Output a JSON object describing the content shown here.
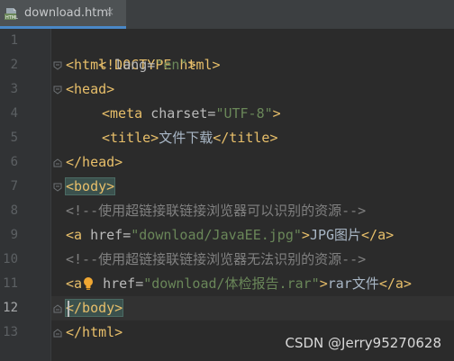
{
  "tab": {
    "filename": "download.html",
    "close_glyph": "×",
    "icon": "html-file-icon"
  },
  "gutter": {
    "lines": [
      "1",
      "2",
      "3",
      "4",
      "5",
      "6",
      "7",
      "8",
      "9",
      "10",
      "11",
      "12",
      "13"
    ],
    "active_line": "12"
  },
  "code": {
    "l1": {
      "tag": "<!DOCTYPE html>"
    },
    "l2": {
      "open": "<html ",
      "attr": "lang=",
      "val": "\"en\"",
      "close": ">"
    },
    "l3": {
      "tag": "<head>"
    },
    "l4": {
      "open": "<meta ",
      "attr": "charset=",
      "val": "\"UTF-8\"",
      "close": ">"
    },
    "l5": {
      "open": "<title>",
      "text": "文件下载",
      "close": "</title>"
    },
    "l6": {
      "tag": "</head>"
    },
    "l7": {
      "tag": "<body>"
    },
    "l8": {
      "comment": "<!--使用超链接联链接浏览器可以识别的资源-->"
    },
    "l9": {
      "open": "<a ",
      "attr": "href=",
      "val": "\"download/JavaEE.jpg\"",
      "gt": ">",
      "text": "JPG图片",
      "close": "</a>"
    },
    "l10": {
      "comment": "<!--使用超链接联链接浏览器无法识别的资源-->"
    },
    "l11": {
      "open": "<a",
      "attr": " href=",
      "val": "\"download/体检报告.rar\"",
      "gt": ">",
      "text": "rar文件",
      "close": "</a>"
    },
    "l12": {
      "tag": "</body>"
    },
    "l13": {
      "tag": "</html>"
    }
  },
  "watermark": "CSDN @Jerry95270628",
  "colors": {
    "background": "#2b2b2b",
    "gutter": "#313335",
    "tag": "#e8bf6a",
    "attribute": "#bababa",
    "string": "#6a8759",
    "comment": "#808080",
    "text": "#a9b7c6",
    "body_highlight": "#3b514d"
  }
}
